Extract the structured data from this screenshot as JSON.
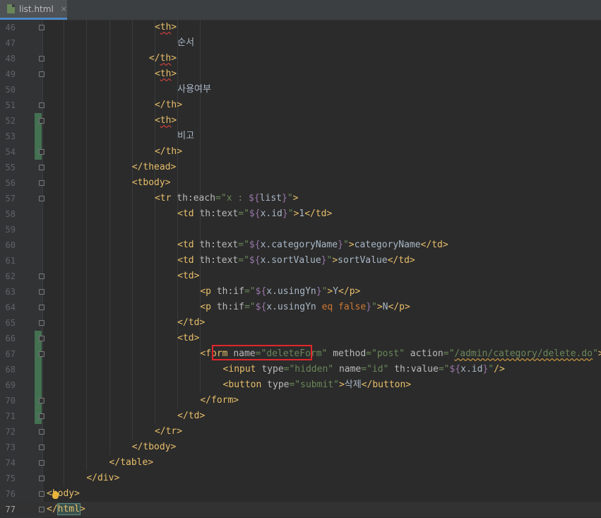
{
  "tab": {
    "file_name": "list.html",
    "close": "×"
  },
  "lines": [
    {
      "num": "46",
      "indent": 19,
      "parts": [
        [
          "t",
          "<"
        ],
        [
          "tw",
          "th"
        ],
        [
          "t",
          ">"
        ]
      ]
    },
    {
      "num": "47",
      "indent": 23,
      "parts": [
        [
          "k",
          "순서"
        ]
      ]
    },
    {
      "num": "48",
      "indent": 18,
      "parts": [
        [
          "t",
          "</"
        ],
        [
          "tw",
          "th"
        ],
        [
          "t",
          ">"
        ]
      ]
    },
    {
      "num": "49",
      "indent": 19,
      "parts": [
        [
          "t",
          "<"
        ],
        [
          "tw",
          "th"
        ],
        [
          "t",
          ">"
        ]
      ]
    },
    {
      "num": "50",
      "indent": 23,
      "parts": [
        [
          "k",
          "사용여부"
        ]
      ]
    },
    {
      "num": "51",
      "indent": 19,
      "parts": [
        [
          "t",
          "</"
        ],
        [
          "t",
          "th"
        ],
        [
          "t",
          ">"
        ]
      ]
    },
    {
      "num": "52",
      "indent": 19,
      "parts": [
        [
          "t",
          "<"
        ],
        [
          "tw",
          "th"
        ],
        [
          "t",
          ">"
        ]
      ]
    },
    {
      "num": "53",
      "indent": 23,
      "parts": [
        [
          "k",
          "비고"
        ]
      ]
    },
    {
      "num": "54",
      "indent": 19,
      "parts": [
        [
          "t",
          "</"
        ],
        [
          "t",
          "th"
        ],
        [
          "t",
          ">"
        ]
      ]
    },
    {
      "num": "55",
      "indent": 15,
      "parts": [
        [
          "t",
          "</thead>"
        ]
      ]
    },
    {
      "num": "56",
      "indent": 15,
      "parts": [
        [
          "t",
          "<tbody>"
        ]
      ]
    },
    {
      "num": "57",
      "indent": 19,
      "parts": [
        [
          "t",
          "<tr "
        ],
        [
          "a",
          "th:each"
        ],
        [
          "s",
          "=\"x : "
        ],
        [
          "th",
          "${"
        ],
        [
          "p",
          "list"
        ],
        [
          "th",
          "}"
        ],
        [
          "s",
          "\""
        ],
        [
          "t",
          ">"
        ]
      ]
    },
    {
      "num": "58",
      "indent": 23,
      "parts": [
        [
          "t",
          "<td "
        ],
        [
          "a",
          "th:text"
        ],
        [
          "s",
          "=\""
        ],
        [
          "th",
          "${"
        ],
        [
          "p",
          "x.id"
        ],
        [
          "th",
          "}"
        ],
        [
          "s",
          "\""
        ],
        [
          "t",
          ">"
        ],
        [
          "p",
          "1"
        ],
        [
          "t",
          "</td>"
        ]
      ]
    },
    {
      "num": "59",
      "indent": 0,
      "parts": []
    },
    {
      "num": "60",
      "indent": 23,
      "parts": [
        [
          "t",
          "<td "
        ],
        [
          "a",
          "th:text"
        ],
        [
          "s",
          "=\""
        ],
        [
          "th",
          "${"
        ],
        [
          "p",
          "x.categoryName"
        ],
        [
          "th",
          "}"
        ],
        [
          "s",
          "\""
        ],
        [
          "t",
          ">"
        ],
        [
          "p",
          "categoryName"
        ],
        [
          "t",
          "</td>"
        ]
      ]
    },
    {
      "num": "61",
      "indent": 23,
      "parts": [
        [
          "t",
          "<td "
        ],
        [
          "a",
          "th:text"
        ],
        [
          "s",
          "=\""
        ],
        [
          "th",
          "${"
        ],
        [
          "p",
          "x.sortValue"
        ],
        [
          "th",
          "}"
        ],
        [
          "s",
          "\""
        ],
        [
          "t",
          ">"
        ],
        [
          "p",
          "sortValue"
        ],
        [
          "t",
          "</td>"
        ]
      ]
    },
    {
      "num": "62",
      "indent": 23,
      "parts": [
        [
          "t",
          "<td>"
        ]
      ]
    },
    {
      "num": "63",
      "indent": 27,
      "parts": [
        [
          "t",
          "<p "
        ],
        [
          "a",
          "th:if"
        ],
        [
          "s",
          "=\""
        ],
        [
          "th",
          "${"
        ],
        [
          "p",
          "x.usingYn"
        ],
        [
          "th",
          "}"
        ],
        [
          "s",
          "\""
        ],
        [
          "t",
          ">"
        ],
        [
          "p",
          "Y"
        ],
        [
          "t",
          "</p>"
        ]
      ]
    },
    {
      "num": "64",
      "indent": 27,
      "parts": [
        [
          "t",
          "<p "
        ],
        [
          "a",
          "th:if"
        ],
        [
          "s",
          "=\""
        ],
        [
          "th",
          "${"
        ],
        [
          "p",
          "x.usingYn "
        ],
        [
          "x",
          "eq"
        ],
        [
          "p",
          " "
        ],
        [
          "x",
          "false"
        ],
        [
          "th",
          "}"
        ],
        [
          "s",
          "\""
        ],
        [
          "t",
          ">"
        ],
        [
          "p",
          "N"
        ],
        [
          "t",
          "</p>"
        ]
      ]
    },
    {
      "num": "65",
      "indent": 23,
      "parts": [
        [
          "t",
          "</td>"
        ]
      ]
    },
    {
      "num": "66",
      "indent": 23,
      "parts": [
        [
          "t",
          "<td>"
        ]
      ]
    },
    {
      "num": "67",
      "indent": 27,
      "parts": [
        [
          "t",
          "<form "
        ],
        [
          "a",
          "name"
        ],
        [
          "s",
          "=\"deleteForm\""
        ],
        [
          "p",
          " "
        ],
        [
          "a",
          "method"
        ],
        [
          "s",
          "=\"post\""
        ],
        [
          "p",
          " "
        ],
        [
          "a",
          "action"
        ],
        [
          "s",
          "=\""
        ],
        [
          "u",
          "/admin/category/delete.do"
        ],
        [
          "s",
          "\""
        ],
        [
          "t",
          ">"
        ]
      ]
    },
    {
      "num": "68",
      "indent": 31,
      "parts": [
        [
          "t",
          "<input "
        ],
        [
          "a",
          "type"
        ],
        [
          "s",
          "=\"hidden\""
        ],
        [
          "p",
          " "
        ],
        [
          "a",
          "name"
        ],
        [
          "s",
          "=\"id\""
        ],
        [
          "p",
          " "
        ],
        [
          "a",
          "th:value"
        ],
        [
          "s",
          "=\""
        ],
        [
          "th",
          "${"
        ],
        [
          "p",
          "x.id"
        ],
        [
          "th",
          "}"
        ],
        [
          "s",
          "\""
        ],
        [
          "t",
          "/>"
        ]
      ]
    },
    {
      "num": "69",
      "indent": 31,
      "parts": [
        [
          "t",
          "<button "
        ],
        [
          "a",
          "type"
        ],
        [
          "s",
          "=\"submit\""
        ],
        [
          "t",
          ">"
        ],
        [
          "k",
          "삭제"
        ],
        [
          "t",
          "</button>"
        ]
      ]
    },
    {
      "num": "70",
      "indent": 27,
      "parts": [
        [
          "t",
          "</form>"
        ]
      ]
    },
    {
      "num": "71",
      "indent": 23,
      "parts": [
        [
          "t",
          "</td>"
        ]
      ]
    },
    {
      "num": "72",
      "indent": 19,
      "parts": [
        [
          "t",
          "</tr>"
        ]
      ]
    },
    {
      "num": "73",
      "indent": 15,
      "parts": [
        [
          "t",
          "</tbody>"
        ]
      ]
    },
    {
      "num": "74",
      "indent": 11,
      "parts": [
        [
          "t",
          "</table>"
        ]
      ]
    },
    {
      "num": "75",
      "indent": 7,
      "parts": [
        [
          "t",
          "</div>"
        ]
      ]
    },
    {
      "num": "76",
      "indent": 0,
      "parts": [
        [
          "t",
          "<"
        ],
        [
          "t",
          "body"
        ],
        [
          "t",
          ">"
        ]
      ]
    },
    {
      "num": "77",
      "indent": 0,
      "parts": [
        [
          "t",
          "</"
        ],
        [
          "c",
          "html"
        ],
        [
          "t",
          ">"
        ]
      ]
    }
  ],
  "current_line": "77",
  "change_marks": [
    "52",
    "53",
    "54",
    "66",
    "67",
    "68",
    "69",
    "70",
    "71"
  ],
  "colors": {
    "tag": "#e8bf6a",
    "attribute": "#bababa",
    "string": "#6a8759",
    "template": "#9876aa",
    "keyword": "#cc7832",
    "highlight_box": "#e3262b",
    "vcs_added": "#447152"
  },
  "icons": [
    "html-file-icon",
    "close-icon",
    "fold-marker-icon",
    "lightbulb-icon"
  ]
}
